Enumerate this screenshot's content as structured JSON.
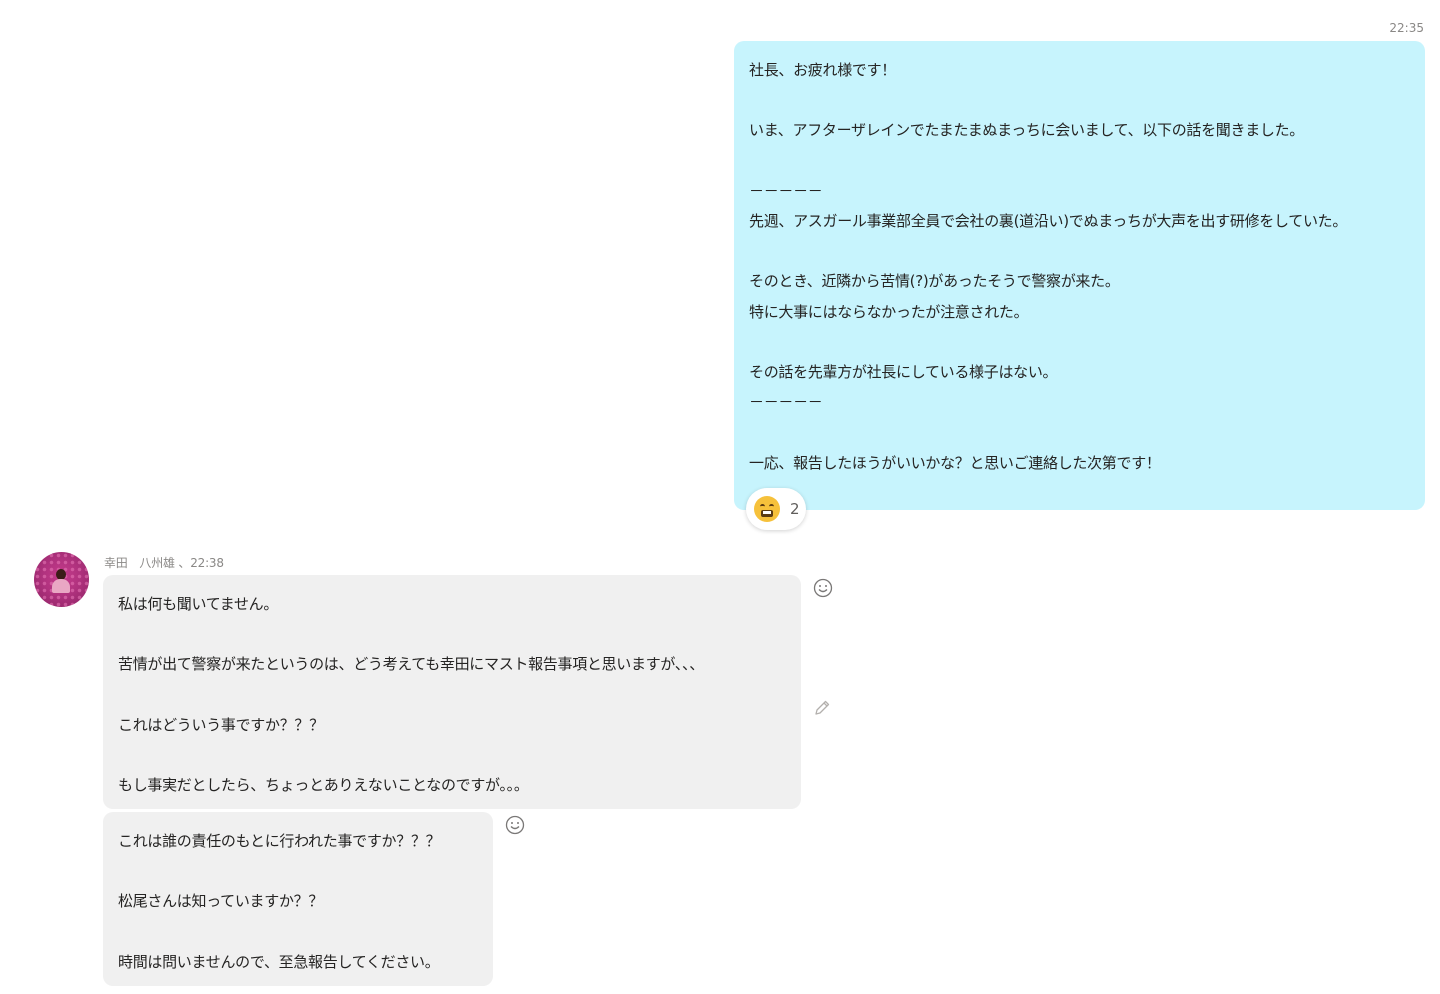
{
  "outgoing": {
    "time": "22:35",
    "text": "社長、お疲れ様です！\n\nいま、アフターザレインでたまたまぬまっちに会いまして、以下の話を聞きました。\n\n－－－－－\n先週、アスガール事業部全員で会社の裏(道沿い)でぬまっちが大声を出す研修をしていた。\n\nそのとき、近隣から苦情(?)があったそうで警察が来た。\n特に大事にはならなかったが注意された。\n\nその話を先輩方が社長にしている様子はない。\n－－－－－\n\n一応、報告したほうがいいかな？と思いご連絡した次第です！",
    "reaction": {
      "emoji": "fearful-face-icon",
      "count": "2"
    }
  },
  "incoming": {
    "sender_meta": "幸田　八州雄 、22:38",
    "messages": [
      {
        "text": "私は何も聞いてません。\n\n苦情が出て警察が来たというのは、どう考えても幸田にマスト報告事項と思いますが、、、\n\nこれはどういう事ですか？？？\n\nもし事実だとしたら、ちょっとありえないことなのですが。。。"
      },
      {
        "text": "これは誰の責任のもとに行われた事ですか？？？\n\n松尾さんは知っていますか？？\n\n時間は問いませんので、至急報告してください。"
      }
    ]
  },
  "colors": {
    "outgoing_bubble": "#c7f4fd",
    "incoming_bubble": "#f0f0f0",
    "meta_text": "#8a8886"
  }
}
